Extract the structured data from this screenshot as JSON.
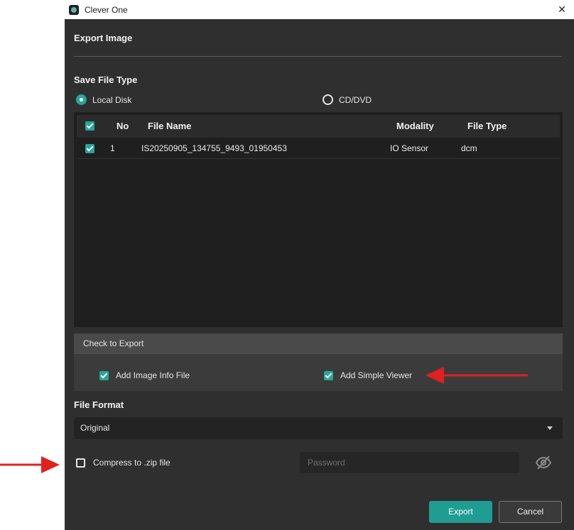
{
  "window": {
    "title": "Clever One",
    "close_glyph": "✕"
  },
  "dialog": {
    "title": "Export Image",
    "save_file_type": {
      "label": "Save File Type",
      "options": [
        {
          "label": "Local Disk",
          "selected": true
        },
        {
          "label": "CD/DVD",
          "selected": false
        }
      ]
    },
    "table": {
      "columns": [
        "No",
        "File Name",
        "Modality",
        "File Type"
      ],
      "header_checked": true,
      "rows": [
        {
          "checked": true,
          "no": "1",
          "file_name": "IS20250905_134755_9493_01950453",
          "modality": "IO Sensor",
          "file_type": "dcm"
        }
      ]
    },
    "check_to_export": {
      "label": "Check to Export",
      "items": [
        {
          "label": "Add Image Info File",
          "checked": true
        },
        {
          "label": "Add Simple Viewer",
          "checked": true
        }
      ]
    },
    "file_format": {
      "label": "File Format",
      "selected": "Original"
    },
    "compress": {
      "label": "Compress to .zip file",
      "checked": false
    },
    "password": {
      "placeholder": "Password",
      "value": ""
    },
    "buttons": {
      "export": "Export",
      "cancel": "Cancel"
    }
  },
  "icons": {
    "eye_toggle": "eye-off-icon",
    "app": "app-logo-icon"
  },
  "colors": {
    "accent": "#1f9d93",
    "arrow": "#e0211f",
    "panel_bg": "#2f2f2f"
  }
}
